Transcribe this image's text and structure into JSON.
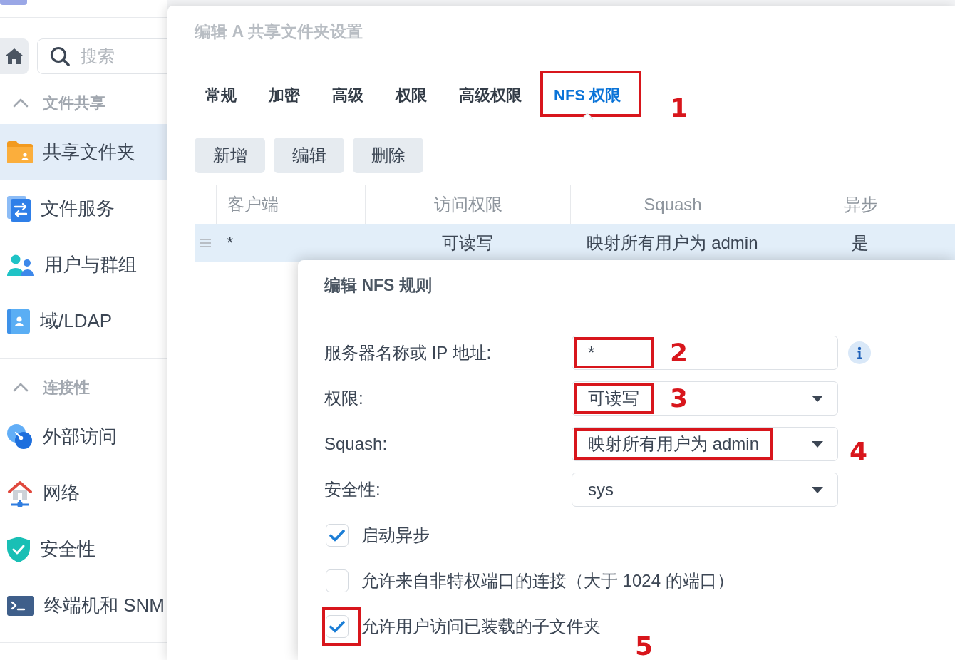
{
  "sidebar": {
    "search": {
      "placeholder": "搜索"
    },
    "sections": [
      {
        "title": "文件共享",
        "expanded": true,
        "items": [
          {
            "label": "共享文件夹",
            "selected": true
          },
          {
            "label": "文件服务",
            "selected": false
          },
          {
            "label": "用户与群组",
            "selected": false
          },
          {
            "label": "域/LDAP",
            "selected": false
          }
        ]
      },
      {
        "title": "连接性",
        "expanded": true,
        "items": [
          {
            "label": "外部访问",
            "selected": false
          },
          {
            "label": "网络",
            "selected": false
          },
          {
            "label": "安全性",
            "selected": false
          },
          {
            "label": "终端机和 SNM",
            "selected": false
          }
        ]
      }
    ]
  },
  "window": {
    "title": "编辑 A 共享文件夹设置",
    "tabs": [
      {
        "label": "常规",
        "selected": false
      },
      {
        "label": "加密",
        "selected": false
      },
      {
        "label": "高级",
        "selected": false
      },
      {
        "label": "权限",
        "selected": false
      },
      {
        "label": "高级权限",
        "selected": false
      },
      {
        "label": "NFS 权限",
        "selected": true,
        "callout": "1"
      }
    ],
    "toolbar": [
      "新增",
      "编辑",
      "删除"
    ],
    "table": {
      "columns": [
        "客户端",
        "访问权限",
        "Squash",
        "异步"
      ],
      "rows": [
        {
          "selected": true,
          "cells": [
            "*",
            "可读写",
            "映射所有用户为 admin",
            "是"
          ]
        }
      ]
    }
  },
  "dialog": {
    "title": "编辑 NFS 规则",
    "fields": [
      {
        "kind": "text",
        "label": "服务器名称或 IP 地址:",
        "value": "*",
        "help": true,
        "callout": "2"
      },
      {
        "kind": "select",
        "label": "权限:",
        "value": "可读写",
        "help": false,
        "callout": "3"
      },
      {
        "kind": "select",
        "label": "Squash:",
        "value": "映射所有用户为 admin",
        "help": false,
        "callout": "4"
      },
      {
        "kind": "select",
        "label": "安全性:",
        "value": "sys",
        "help": false
      }
    ],
    "checkboxes": [
      {
        "label": "启动异步",
        "checked": true
      },
      {
        "label": "允许来自非特权端口的连接（大于 1024 的端口）",
        "checked": false
      },
      {
        "label": "允许用户访问已装载的子文件夹",
        "checked": true,
        "callout": "5"
      }
    ]
  }
}
